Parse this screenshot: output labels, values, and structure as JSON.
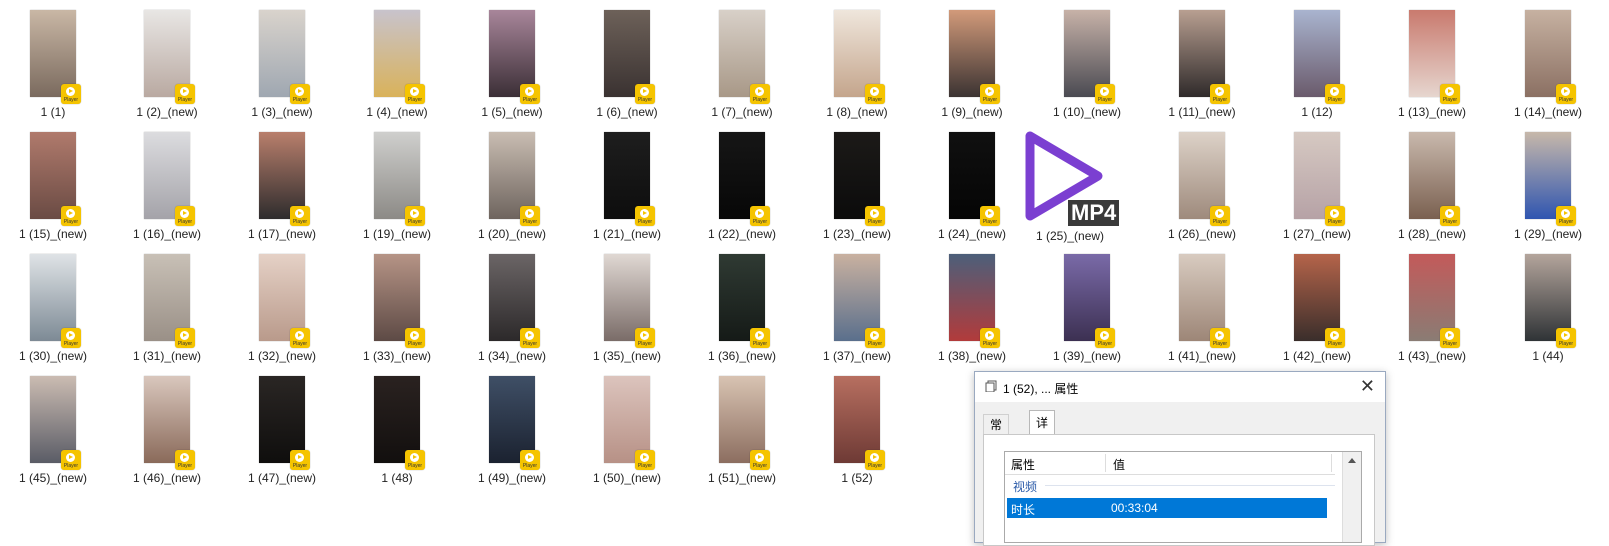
{
  "badge_label": "Player",
  "items": [
    {
      "label": "1 (1)",
      "c1": "#c9b7a5",
      "c2": "#7a6a5e"
    },
    {
      "label": "1 (2)_(new)",
      "c1": "#e8e6e4",
      "c2": "#b9a9a1"
    },
    {
      "label": "1 (3)_(new)",
      "c1": "#d9d3cc",
      "c2": "#9fa7b1"
    },
    {
      "label": "1 (4)_(new)",
      "c1": "#c8c3cc",
      "c2": "#d9b25a"
    },
    {
      "label": "1 (5)_(new)",
      "c1": "#a8869a",
      "c2": "#3b2f36"
    },
    {
      "label": "1 (6)_(new)",
      "c1": "#6d6159",
      "c2": "#3a3231"
    },
    {
      "label": "1 (7)_(new)",
      "c1": "#d8d0c8",
      "c2": "#a89887"
    },
    {
      "label": "1 (8)_(new)",
      "c1": "#efe6dc",
      "c2": "#c4a58c"
    },
    {
      "label": "1 (9)_(new)",
      "c1": "#d29a7a",
      "c2": "#3b3332"
    },
    {
      "label": "1 (10)_(new)",
      "c1": "#c7b2a8",
      "c2": "#4a4a52"
    },
    {
      "label": "1 (11)_(new)",
      "c1": "#b89f91",
      "c2": "#2f2a2a"
    },
    {
      "label": "1 (12)",
      "c1": "#a9b4cf",
      "c2": "#6a5a6b"
    },
    {
      "label": "1 (13)_(new)",
      "c1": "#c97a6e",
      "c2": "#e6d6cf"
    },
    {
      "label": "1 (14)_(new)",
      "c1": "#c6b1a1",
      "c2": "#8b7063"
    },
    {
      "label": "1 (15)_(new)",
      "c1": "#b07a6c",
      "c2": "#6a4b44"
    },
    {
      "label": "1 (16)_(new)",
      "c1": "#dcdcdf",
      "c2": "#a4a3a9"
    },
    {
      "label": "1 (17)_(new)",
      "c1": "#b97f6c",
      "c2": "#2e2c2d"
    },
    {
      "label": "1 (19)_(new)",
      "c1": "#cfcfcd",
      "c2": "#8c8a86"
    },
    {
      "label": "1 (20)_(new)",
      "c1": "#c9bdb2",
      "c2": "#6e645e"
    },
    {
      "label": "1 (21)_(new)",
      "c1": "#1e1e1e",
      "c2": "#0d0d0d"
    },
    {
      "label": "1 (22)_(new)",
      "c1": "#161616",
      "c2": "#070707"
    },
    {
      "label": "1 (23)_(new)",
      "c1": "#1c1a18",
      "c2": "#0b0b0b"
    },
    {
      "label": "1 (24)_(new)",
      "c1": "#101010",
      "c2": "#050505"
    },
    {
      "label": "",
      "c1": "",
      "c2": ""
    },
    {
      "label": "1 (26)_(new)",
      "c1": "#ddd2c8",
      "c2": "#9e8a7c"
    },
    {
      "label": "1 (27)_(new)",
      "c1": "#d6c9c2",
      "c2": "#b6a2a6"
    },
    {
      "label": "1 (28)_(new)",
      "c1": "#c9b9ad",
      "c2": "#7a6050"
    },
    {
      "label": "1 (29)_(new)",
      "c1": "#c7b8aa",
      "c2": "#2f55b0"
    },
    {
      "label": "1 (30)_(new)",
      "c1": "#dfe3e6",
      "c2": "#7d8a95"
    },
    {
      "label": "1 (31)_(new)",
      "c1": "#c8c0b6",
      "c2": "#9a9087"
    },
    {
      "label": "1 (32)_(new)",
      "c1": "#e5d1c6",
      "c2": "#b99a8b"
    },
    {
      "label": "1 (33)_(new)",
      "c1": "#b69486",
      "c2": "#5d4a45"
    },
    {
      "label": "1 (34)_(new)",
      "c1": "#6b6566",
      "c2": "#2c292a"
    },
    {
      "label": "1 (35)_(new)",
      "c1": "#e0d8d3",
      "c2": "#7a6c68"
    },
    {
      "label": "1 (36)_(new)",
      "c1": "#2f3a33",
      "c2": "#151a17"
    },
    {
      "label": "1 (37)_(new)",
      "c1": "#c9b1a0",
      "c2": "#5a6f8c"
    },
    {
      "label": "1 (38)_(new)",
      "c1": "#4c5f7a",
      "c2": "#b23b3b"
    },
    {
      "label": "1 (39)_(new)",
      "c1": "#7a6aa8",
      "c2": "#3c3052"
    },
    {
      "label": "1 (41)_(new)",
      "c1": "#d8cbc0",
      "c2": "#9d8677"
    },
    {
      "label": "1 (42)_(new)",
      "c1": "#b5644a",
      "c2": "#3a2e2b"
    },
    {
      "label": "1 (43)_(new)",
      "c1": "#c35a5a",
      "c2": "#8a7c74"
    },
    {
      "label": "1 (44)",
      "c1": "#b4a59c",
      "c2": "#2f3336"
    },
    {
      "label": "1 (45)_(new)",
      "c1": "#cbbcb2",
      "c2": "#5a5c66"
    },
    {
      "label": "1 (46)_(new)",
      "c1": "#d9c7bd",
      "c2": "#8a6a5a"
    },
    {
      "label": "1 (47)_(new)",
      "c1": "#2a2624",
      "c2": "#0f0e0d"
    },
    {
      "label": "1 (48)",
      "c1": "#2a2220",
      "c2": "#120f0e"
    },
    {
      "label": "1 (49)_(new)",
      "c1": "#3f4f66",
      "c2": "#1b2230"
    },
    {
      "label": "1 (50)_(new)",
      "c1": "#dcc4bd",
      "c2": "#b79186"
    },
    {
      "label": "1 (51)_(new)",
      "c1": "#d8c3b2",
      "c2": "#8c6e60"
    },
    {
      "label": "1 (52)",
      "c1": "#b76f60",
      "c2": "#6e3a35"
    }
  ],
  "large_icon": {
    "label": "1 (25)_(new)",
    "text": "MP4",
    "icon": "play-icon",
    "color": "#7b3fd1"
  },
  "dialog": {
    "title": "1 (52), ... 属性",
    "tabs": [
      "常规",
      "详细信息"
    ],
    "active_tab": "详细信息",
    "columns": [
      "属性",
      "值"
    ],
    "group": "视频",
    "selected_row": {
      "property": "时长",
      "value": "00:33:04"
    },
    "accent": "#0078d7"
  }
}
